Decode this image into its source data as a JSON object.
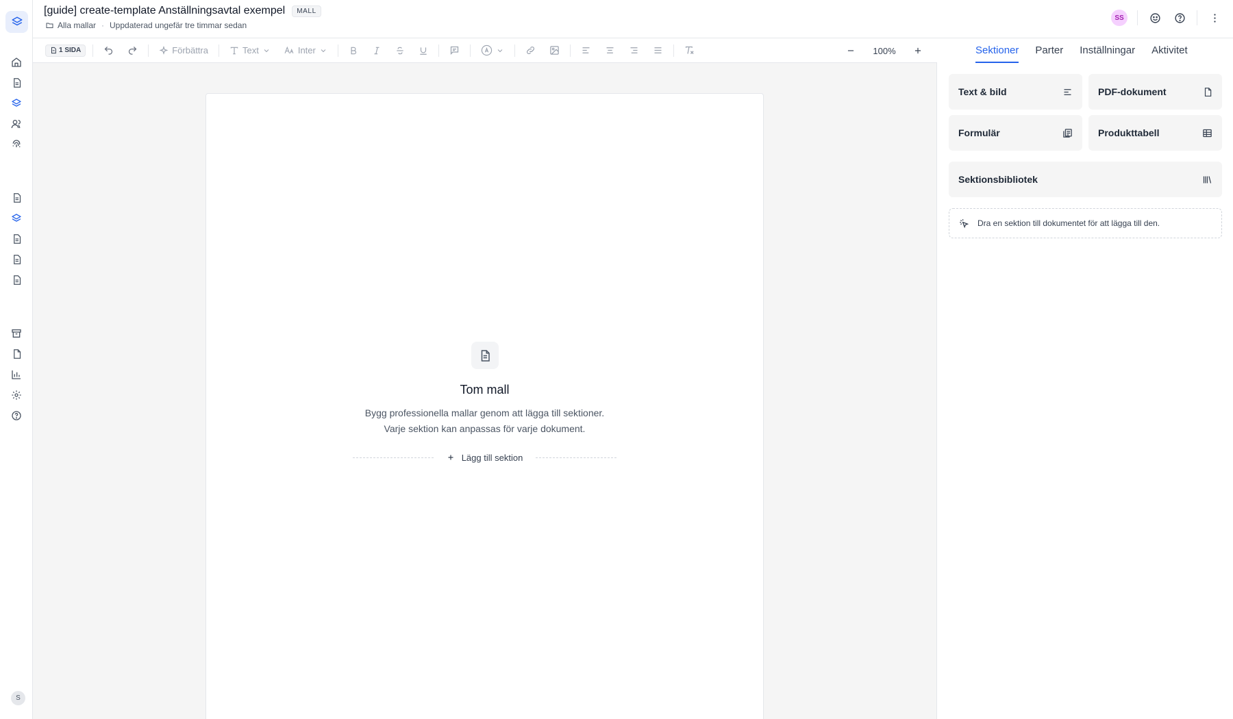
{
  "document": {
    "title": "[guide] create-template Anställningsavtal exempel",
    "badge": "MALL",
    "breadcrumb_link": "Alla mallar",
    "separator": "·",
    "updated": "Uppdaterad ungefär tre timmar sedan"
  },
  "header": {
    "avatar_initials": "SS"
  },
  "toolbar": {
    "page_count": "1 SIDA",
    "improve_label": "Förbättra",
    "text_style_label": "Text",
    "font_label": "Inter",
    "zoom_value": "100%"
  },
  "canvas": {
    "empty_title": "Tom mall",
    "empty_line1": "Bygg professionella mallar genom att lägga till sektioner.",
    "empty_line2": "Varje sektion kan anpassas för varje dokument.",
    "add_section_label": "Lägg till sektion"
  },
  "panel": {
    "tabs": [
      "Sektioner",
      "Parter",
      "Inställningar",
      "Aktivitet"
    ],
    "active_tab": "Sektioner",
    "cards": [
      "Text & bild",
      "PDF-dokument",
      "Formulär",
      "Produkttabell",
      "Sektionsbibliotek"
    ],
    "hint": "Dra en sektion till dokumentet för att lägga till den."
  },
  "rail": {
    "user_initial": "S"
  },
  "colors": {
    "accent": "#2563eb",
    "avatar_bg": "#f5d0fe",
    "canvas_bg": "#f5f5f5"
  }
}
